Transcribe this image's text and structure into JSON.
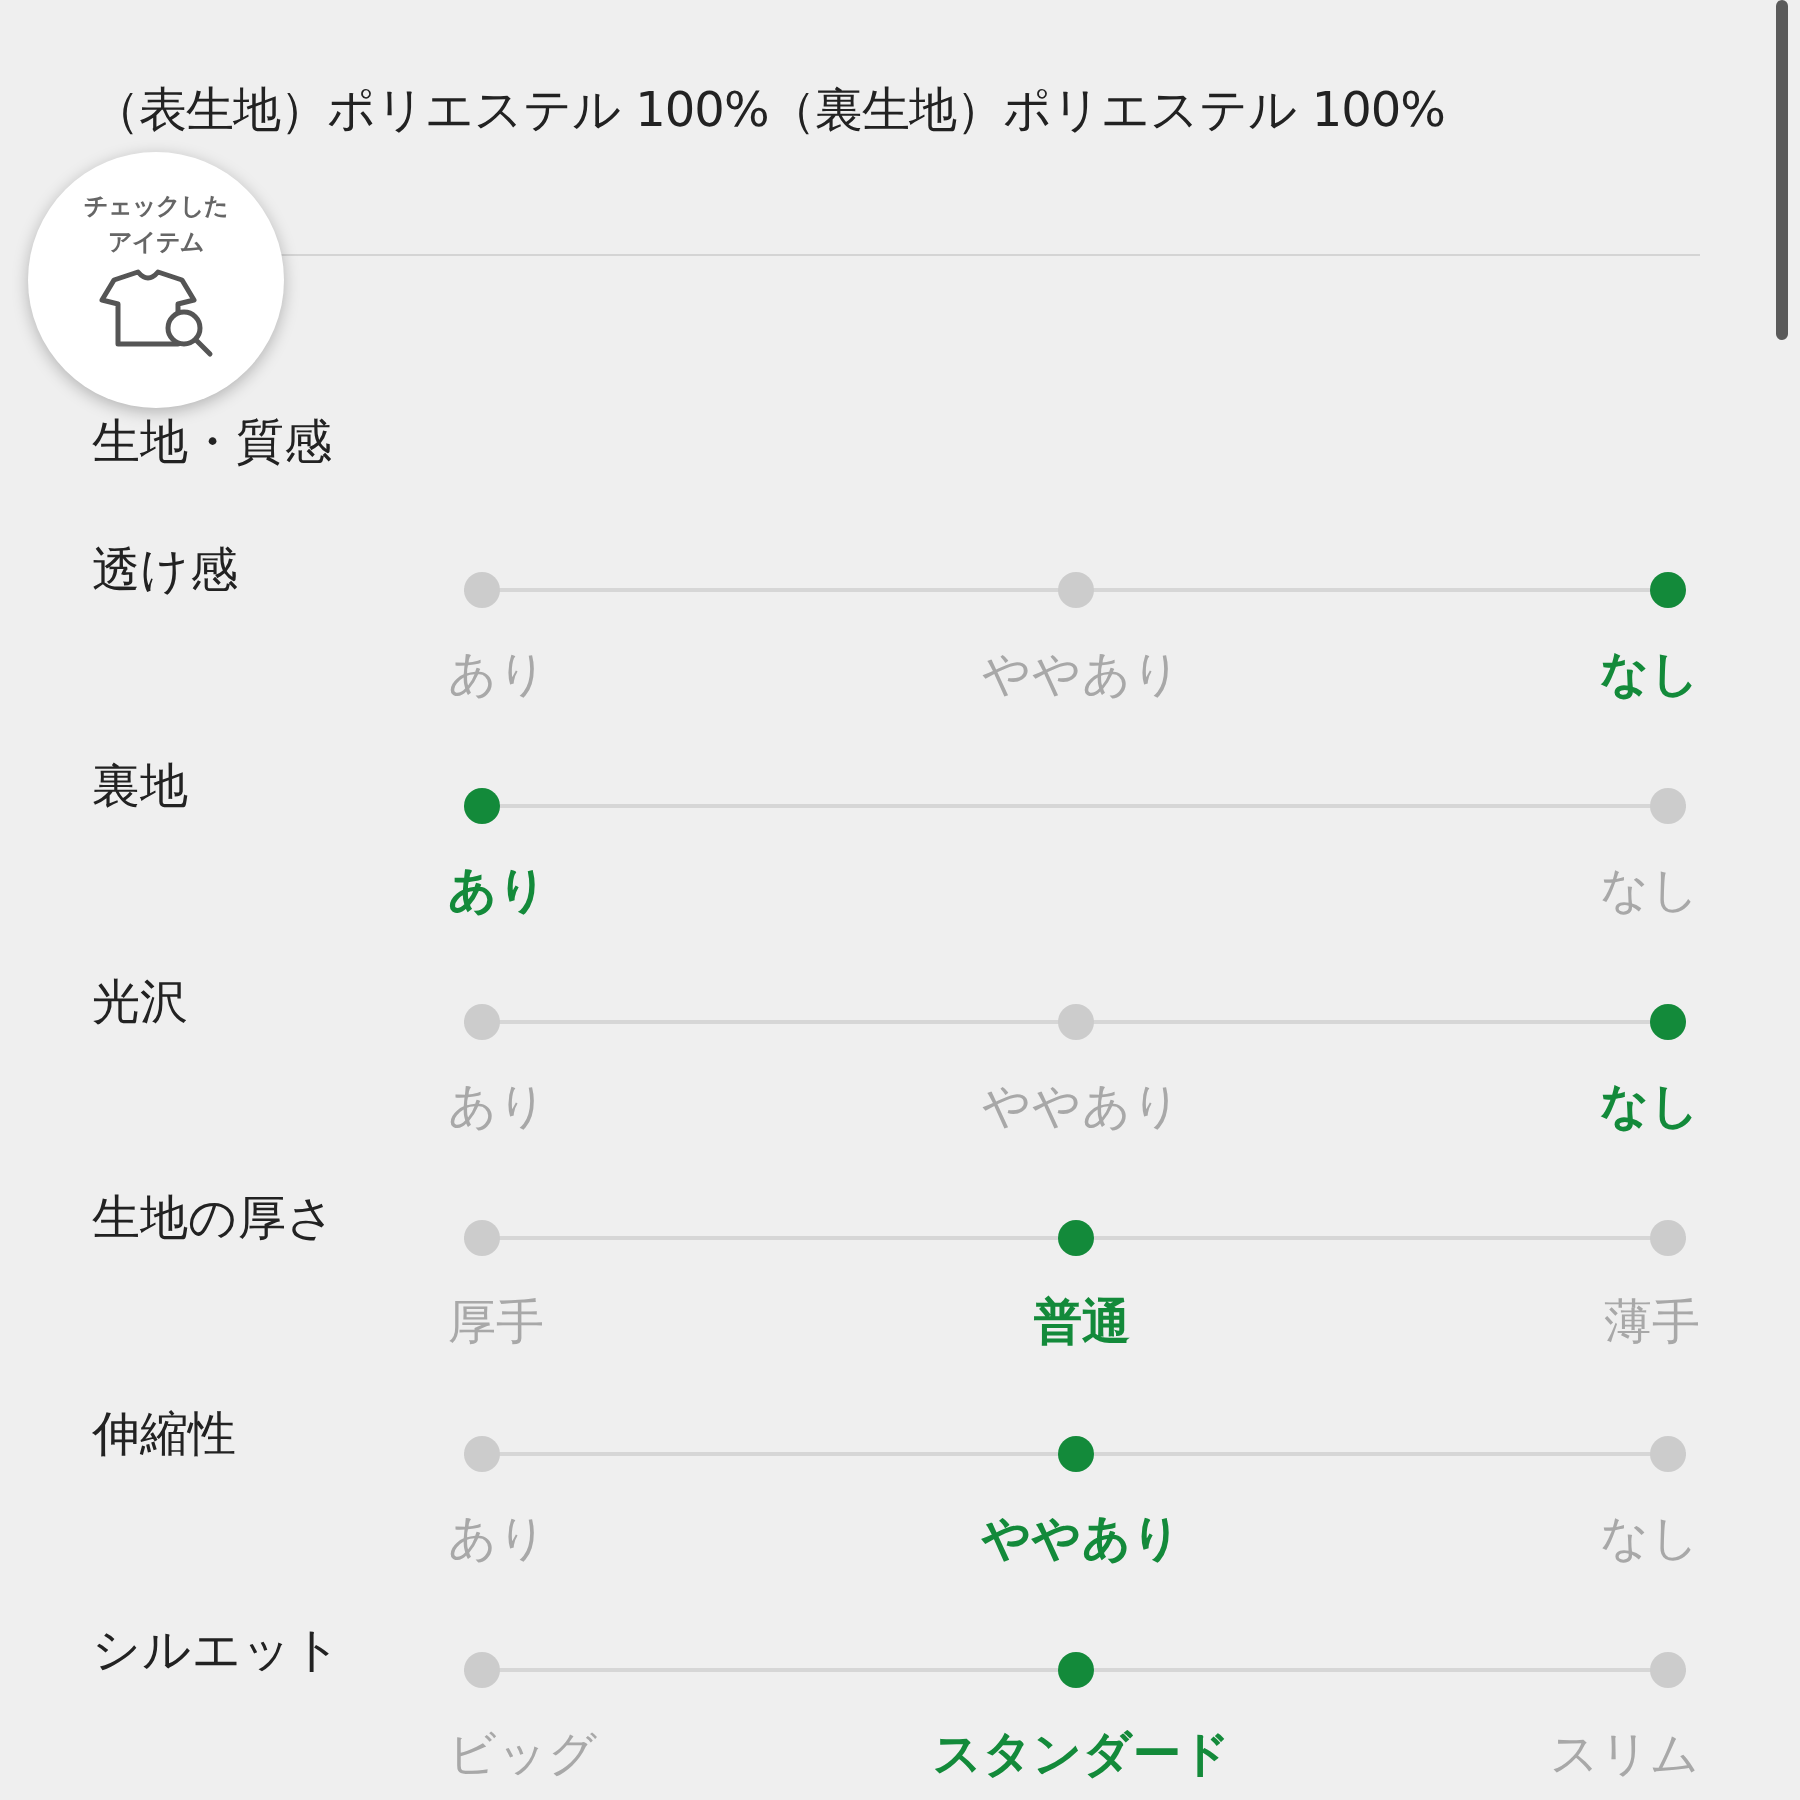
{
  "material": {
    "text": "（表生地）ポリエステル 100%（裏生地）ポリエステル 100%"
  },
  "section_title": "生地・質感",
  "attributes": [
    {
      "label": "透け感",
      "options": [
        {
          "text": "あり",
          "selected": false
        },
        {
          "text": "ややあり",
          "selected": false
        },
        {
          "text": "なし",
          "selected": true
        }
      ]
    },
    {
      "label": "裏地",
      "options": [
        {
          "text": "あり",
          "selected": true
        },
        {
          "text": "なし",
          "selected": false
        }
      ]
    },
    {
      "label": "光沢",
      "options": [
        {
          "text": "あり",
          "selected": false
        },
        {
          "text": "ややあり",
          "selected": false
        },
        {
          "text": "なし",
          "selected": true
        }
      ]
    },
    {
      "label": "生地の厚さ",
      "options": [
        {
          "text": "厚手",
          "selected": false
        },
        {
          "text": "普通",
          "selected": true
        },
        {
          "text": "薄手",
          "selected": false
        }
      ]
    },
    {
      "label": "伸縮性",
      "options": [
        {
          "text": "あり",
          "selected": false
        },
        {
          "text": "ややあり",
          "selected": true
        },
        {
          "text": "なし",
          "selected": false
        }
      ]
    },
    {
      "label": "シルエット",
      "options": [
        {
          "text": "ビッグ",
          "selected": false
        },
        {
          "text": "スタンダード",
          "selected": true
        },
        {
          "text": "スリム",
          "selected": false
        }
      ]
    }
  ],
  "checked_items_button": {
    "label_lines": [
      "チェックした",
      "アイテム"
    ]
  }
}
